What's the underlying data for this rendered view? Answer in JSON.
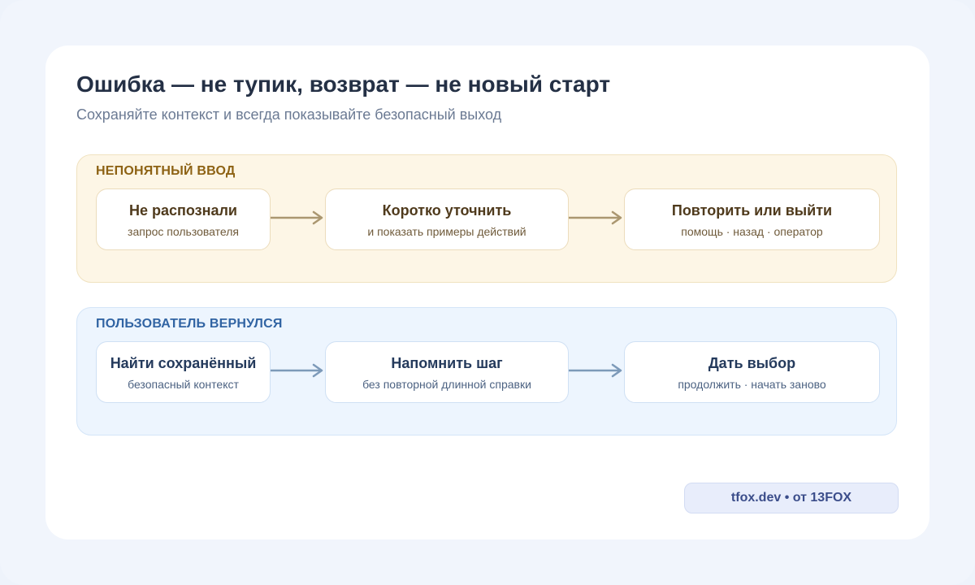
{
  "title": "Ошибка — не тупик, возврат — не новый старт",
  "subtitle": "Сохраняйте контекст и всегда показывайте безопасный выход",
  "colors": {
    "yellow_panel_bg": "#fdf6e6",
    "yellow_accent": "#8d6214",
    "yellow_arrow": "#ab9770",
    "blue_panel_bg": "#edf5fe",
    "blue_accent": "#3164a3",
    "blue_arrow": "#7d9ab9"
  },
  "panels": [
    {
      "label": "НЕПОНЯТНЫЙ ВВОД",
      "steps": [
        {
          "title": "Не распознали",
          "sub": "запрос пользователя"
        },
        {
          "title": "Коротко уточнить",
          "sub": "и показать примеры действий"
        },
        {
          "title": "Повторить или выйти",
          "sub": "помощь · назад · оператор"
        }
      ]
    },
    {
      "label": "ПОЛЬЗОВАТЕЛЬ ВЕРНУЛСЯ",
      "steps": [
        {
          "title": "Найти сохранённый",
          "sub": "безопасный контекст"
        },
        {
          "title": "Напомнить шаг",
          "sub": "без повторной длинной справки"
        },
        {
          "title": "Дать выбор",
          "sub": "продолжить · начать заново"
        }
      ]
    }
  ],
  "footer": {
    "badge": "tfox.dev • от 13FOX"
  }
}
